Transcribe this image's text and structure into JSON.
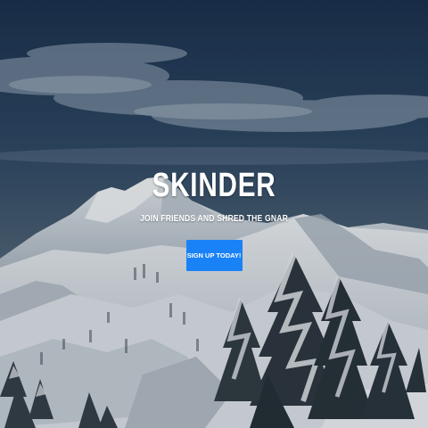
{
  "hero": {
    "title": "SKINDER",
    "tagline": "JOIN FRIENDS AND SHRED THE GNAR",
    "cta_label": "SIGN UP TODAY!"
  },
  "colors": {
    "cta_background": "#1a82f7",
    "text": "#ffffff",
    "sky_top": "#1f3550",
    "snow": "#e8edf2"
  }
}
